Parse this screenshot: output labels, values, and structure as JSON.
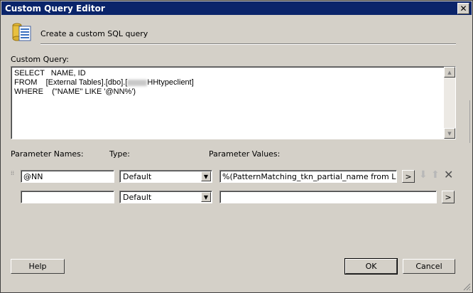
{
  "window": {
    "title": "Custom Query Editor",
    "close_glyph": "✕"
  },
  "header": {
    "text": "Create a custom SQL query",
    "icon": "database-document-icon"
  },
  "query": {
    "label": "Custom Query:",
    "lines": [
      "SELECT   NAME, ID",
      "FROM    [External Tables].[dbo].[",
      "WHERE    (\"NAME\" LIKE '@NN%')"
    ],
    "line2_suffix": "HHtypeclient]"
  },
  "columns": {
    "names": "Parameter Names:",
    "type": "Type:",
    "values": "Parameter Values:"
  },
  "params": [
    {
      "name": "@NN",
      "type": "Default",
      "value": "%(PatternMatching_tkn_partial_name from LF Folc"
    },
    {
      "name": "",
      "type": "Default",
      "value": ""
    }
  ],
  "buttons": {
    "help": "Help",
    "ok": "OK",
    "cancel": "Cancel",
    "browse": ">"
  },
  "colors": {
    "titlebar": "#0a246a",
    "dialog": "#d4d0c8"
  }
}
